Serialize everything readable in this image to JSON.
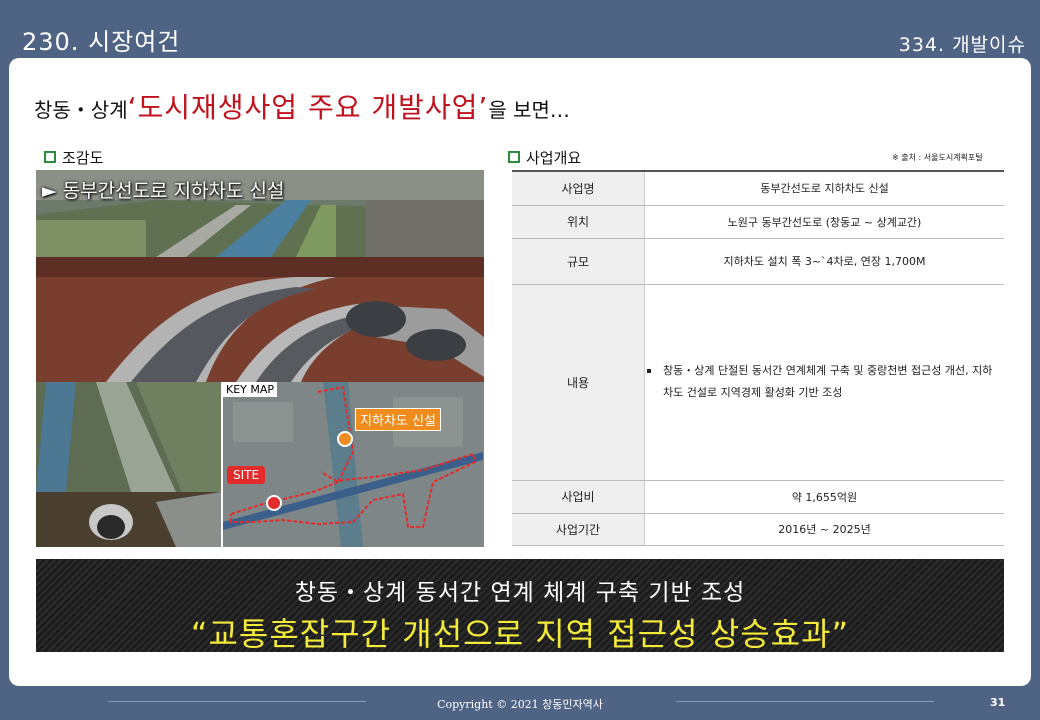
{
  "header": {
    "left_title": "230. 시장여건",
    "right_title": "334. 개발이슈"
  },
  "headline": {
    "prefix": "창동・상계",
    "highlight": "‘도시재생사업 주요 개발사업’",
    "suffix": "을 보면…"
  },
  "left_section": {
    "title": "조감도",
    "image_caption": "► 동부간선도로 지하차도 신설",
    "key_map_label": "KEY MAP",
    "site_label": "SITE",
    "tunnel_label": "지하차도 신설"
  },
  "right_section": {
    "title": "사업개요",
    "source": "※ 출처 : 서울도시계획포털",
    "rows": [
      {
        "key": "사업명",
        "value": "동부간선도로 지하차도 신설"
      },
      {
        "key": "위치",
        "value": "노원구 동부간선도로 (창동교 ~ 상계교간)"
      },
      {
        "key": "규모",
        "value": "지하차도 설치 폭 3~`4차로, 연장 1,700M"
      },
      {
        "key": "내용",
        "value": "창동・상계 단절된 동서간 연계체계 구축 및 중랑천변 접근성 개선, 지하차도 건설로 지역경제 활성화 기반 조성"
      },
      {
        "key": "사업비",
        "value": "약 1,655억원"
      },
      {
        "key": "사업기간",
        "value": "2016년 ~ 2025년"
      }
    ]
  },
  "banner": {
    "line1": "창동・상계 동서간 연계 체계 구축 기반 조성",
    "line2": "“교통혼잡구간 개선으로 지역 접근성 상승효과”"
  },
  "footer": {
    "copyright": "Copyright © 2021 창동민자역사",
    "page_number": "31"
  }
}
